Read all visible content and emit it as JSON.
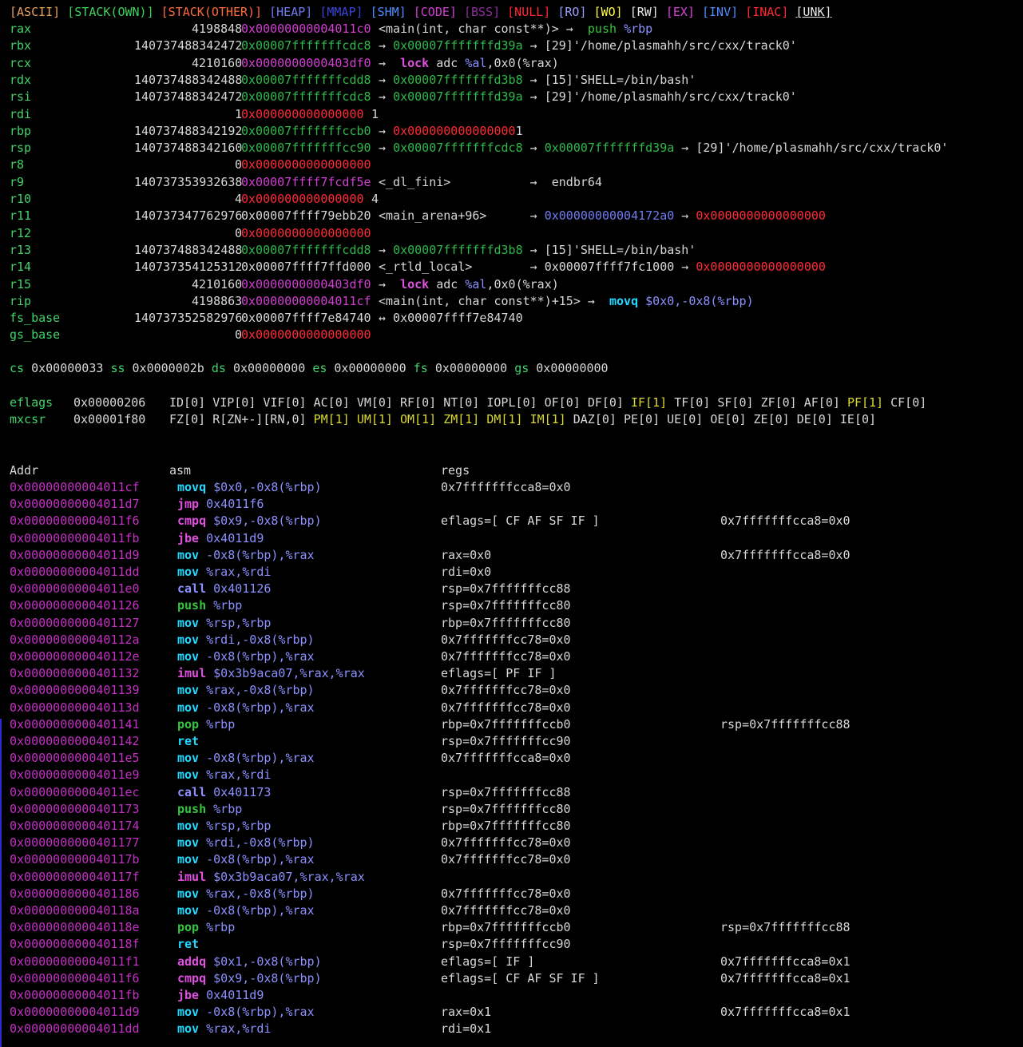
{
  "legend": [
    {
      "text": "[ASCII]",
      "cls": "c-ascii"
    },
    {
      "text": "[STACK(OWN)]",
      "cls": "c-stackown"
    },
    {
      "text": "[STACK(OTHER)]",
      "cls": "c-stackother"
    },
    {
      "text": "[HEAP]",
      "cls": "c-heap"
    },
    {
      "text": "[MMAP]",
      "cls": "c-mmap"
    },
    {
      "text": "[SHM]",
      "cls": "c-shm"
    },
    {
      "text": "[CODE]",
      "cls": "c-code"
    },
    {
      "text": "[BSS]",
      "cls": "c-bss"
    },
    {
      "text": "[NULL]",
      "cls": "c-null"
    },
    {
      "text": "[RO]",
      "cls": "c-ro"
    },
    {
      "text": "[WO]",
      "cls": "c-wo"
    },
    {
      "text": "[RW]",
      "cls": "c-rw"
    },
    {
      "text": "[EX]",
      "cls": "c-ex"
    },
    {
      "text": "[INV]",
      "cls": "c-inv"
    },
    {
      "text": "[INAC]",
      "cls": "c-inac"
    },
    {
      "text": "[UNK]",
      "cls": "c-unk u"
    }
  ],
  "registers": [
    {
      "name": "rax",
      "dec": "4198848",
      "hex": "0x00000000004011c0",
      "hexcls": "hex-mag",
      "rest": [
        [
          "<main(int, char const**)> → ",
          "plain"
        ],
        [
          " push ",
          "inst-green"
        ],
        [
          "%rbp",
          "operand-blue"
        ]
      ]
    },
    {
      "name": "rbx",
      "dec": "140737488342472",
      "hex": "0x00007fffffffcdc8",
      "hexcls": "hex-green",
      "rest": [
        [
          "→ ",
          "plain"
        ],
        [
          "0x00007fffffffd39a",
          "hex-green"
        ],
        [
          " → [29]'/home/plasmahh/src/cxx/track0'",
          "plain"
        ]
      ]
    },
    {
      "name": "rcx",
      "dec": "4210160",
      "hex": "0x0000000000403df0",
      "hexcls": "hex-mag",
      "rest": [
        [
          "→  ",
          "plain"
        ],
        [
          "lock ",
          "inst-mag"
        ],
        [
          "adc ",
          "plain"
        ],
        [
          "%al",
          "operand-blue"
        ],
        [
          ",0x0(%rax)",
          "plain"
        ]
      ]
    },
    {
      "name": "rdx",
      "dec": "140737488342488",
      "hex": "0x00007fffffffcdd8",
      "hexcls": "hex-green",
      "rest": [
        [
          "→ ",
          "plain"
        ],
        [
          "0x00007fffffffd3b8",
          "hex-green"
        ],
        [
          " → [15]'SHELL=/bin/bash'",
          "plain"
        ]
      ]
    },
    {
      "name": "rsi",
      "dec": "140737488342472",
      "hex": "0x00007fffffffcdc8",
      "hexcls": "hex-green",
      "rest": [
        [
          "→ ",
          "plain"
        ],
        [
          "0x00007fffffffd39a",
          "hex-green"
        ],
        [
          " → [29]'/home/plasmahh/src/cxx/track0'",
          "plain"
        ]
      ]
    },
    {
      "name": "rdi",
      "dec": "1",
      "hex": "0x000000000000000",
      "hexcls": "hex-red",
      "rest": [
        [
          "1",
          "plain"
        ]
      ]
    },
    {
      "name": "rbp",
      "dec": "140737488342192",
      "hex": "0x00007fffffffccb0",
      "hexcls": "hex-green",
      "rest": [
        [
          "→ ",
          "plain"
        ],
        [
          "0x000000000000000",
          "hex-red"
        ],
        [
          "1",
          "plain"
        ]
      ]
    },
    {
      "name": "rsp",
      "dec": "140737488342160",
      "hex": "0x00007fffffffcc90",
      "hexcls": "hex-green",
      "rest": [
        [
          "→ ",
          "plain"
        ],
        [
          "0x00007fffffffcdc8",
          "hex-green"
        ],
        [
          " → ",
          "plain"
        ],
        [
          "0x00007fffffffd39a",
          "hex-green"
        ],
        [
          " → [29]'/home/plasmahh/src/cxx/track0'",
          "plain"
        ]
      ]
    },
    {
      "name": "r8",
      "dec": "0",
      "hex": "0x0000000000000000",
      "hexcls": "hex-red",
      "rest": []
    },
    {
      "name": "r9",
      "dec": "140737353932638",
      "hex": "0x00007ffff7fcdf5e",
      "hexcls": "hex-mag",
      "rest": [
        [
          "<_dl_fini>           →  endbr64",
          "plain"
        ]
      ]
    },
    {
      "name": "r10",
      "dec": "4",
      "hex": "0x000000000000000",
      "hexcls": "hex-red",
      "rest": [
        [
          "4",
          "plain"
        ]
      ]
    },
    {
      "name": "r11",
      "dec": "140737347762976",
      "hex": "0x00007ffff79ebb20",
      "hexcls": "plain",
      "rest": [
        [
          "<main_arena+96>      → ",
          "plain"
        ],
        [
          "0x00000000004172a0",
          "c-heap"
        ],
        [
          " → ",
          "plain"
        ],
        [
          "0x0000000000000000",
          "hex-red"
        ]
      ]
    },
    {
      "name": "r12",
      "dec": "0",
      "hex": "0x0000000000000000",
      "hexcls": "hex-red",
      "rest": []
    },
    {
      "name": "r13",
      "dec": "140737488342488",
      "hex": "0x00007fffffffcdd8",
      "hexcls": "hex-green",
      "rest": [
        [
          "→ ",
          "plain"
        ],
        [
          "0x00007fffffffd3b8",
          "hex-green"
        ],
        [
          " → [15]'SHELL=/bin/bash'",
          "plain"
        ]
      ]
    },
    {
      "name": "r14",
      "dec": "140737354125312",
      "hex": "0x00007ffff7ffd000",
      "hexcls": "plain",
      "rest": [
        [
          "<_rtld_local>        → 0x00007ffff7fc1000 → ",
          "plain"
        ],
        [
          "0x0000000000000000",
          "hex-red"
        ]
      ]
    },
    {
      "name": "r15",
      "dec": "4210160",
      "hex": "0x0000000000403df0",
      "hexcls": "hex-mag",
      "rest": [
        [
          "→  ",
          "plain"
        ],
        [
          "lock ",
          "inst-mag"
        ],
        [
          "adc ",
          "plain"
        ],
        [
          "%al",
          "operand-blue"
        ],
        [
          ",0x0(%rax)",
          "plain"
        ]
      ]
    },
    {
      "name": "rip",
      "dec": "4198863",
      "hex": "0x00000000004011cf",
      "hexcls": "hex-mag",
      "rest": [
        [
          "<main(int, char const**)+15> →  ",
          "plain"
        ],
        [
          "movq ",
          "inst-cyan"
        ],
        [
          "$0x0,-0x8(%rbp)",
          "operand-blue"
        ]
      ]
    },
    {
      "name": "fs_base",
      "dec": "140737352582976",
      "hex": "0x00007ffff7e84740",
      "hexcls": "plain",
      "rest": [
        [
          "↔ 0x00007ffff7e84740",
          "plain"
        ]
      ]
    },
    {
      "name": "gs_base",
      "dec": "0",
      "hex": "0x0000000000000000",
      "hexcls": "hex-red",
      "rest": []
    }
  ],
  "segments": [
    {
      "k": "cs",
      "v": "0x00000033"
    },
    {
      "k": "ss",
      "v": "0x0000002b"
    },
    {
      "k": "ds",
      "v": "0x00000000"
    },
    {
      "k": "es",
      "v": "0x00000000"
    },
    {
      "k": "fs",
      "v": "0x00000000"
    },
    {
      "k": "gs",
      "v": "0x00000000"
    }
  ],
  "eflags": {
    "label": "eflags",
    "value": "0x00000206",
    "flags": [
      [
        "ID[0]",
        0
      ],
      [
        "VIP[0]",
        0
      ],
      [
        "VIF[0]",
        0
      ],
      [
        "AC[0]",
        0
      ],
      [
        "VM[0]",
        0
      ],
      [
        "RF[0]",
        0
      ],
      [
        "NT[0]",
        0
      ],
      [
        "IOPL[0]",
        0
      ],
      [
        "OF[0]",
        0
      ],
      [
        "DF[0]",
        0
      ],
      [
        "IF[1]",
        1
      ],
      [
        "TF[0]",
        0
      ],
      [
        "SF[0]",
        0
      ],
      [
        "ZF[0]",
        0
      ],
      [
        "AF[0]",
        0
      ],
      [
        "PF[1]",
        1
      ],
      [
        "CF[0]",
        0
      ]
    ]
  },
  "mxcsr": {
    "label": "mxcsr",
    "value": "0x00001f80",
    "flags": [
      [
        "FZ[0]",
        0
      ],
      [
        "R[ZN+-][RN,0]",
        0
      ],
      [
        "PM[1]",
        1
      ],
      [
        "UM[1]",
        1
      ],
      [
        "OM[1]",
        1
      ],
      [
        "ZM[1]",
        1
      ],
      [
        "DM[1]",
        1
      ],
      [
        "IM[1]",
        1
      ],
      [
        "DAZ[0]",
        0
      ],
      [
        "PE[0]",
        0
      ],
      [
        "UE[0]",
        0
      ],
      [
        "OE[0]",
        0
      ],
      [
        "ZE[0]",
        0
      ],
      [
        "DE[0]",
        0
      ],
      [
        "IE[0]",
        0
      ]
    ]
  },
  "trace_headers": {
    "addr": "Addr",
    "asm": "asm",
    "regs": "regs"
  },
  "trace": [
    [
      "0x00000000004011cf",
      "movq",
      "inst-cyan",
      "$0x0,-0x8(%rbp)",
      "0x7fffffffcca8=0x0",
      ""
    ],
    [
      "0x00000000004011d7",
      "jmp",
      "inst-mag",
      "0x4011f6",
      "",
      ""
    ],
    [
      "0x00000000004011f6",
      "cmpq",
      "inst-mag",
      "$0x9,-0x8(%rbp)",
      "eflags=[ CF AF SF IF ]",
      "0x7fffffffcca8=0x0"
    ],
    [
      "0x00000000004011fb",
      "jbe",
      "inst-mag",
      "0x4011d9",
      "",
      ""
    ],
    [
      "0x00000000004011d9",
      "mov",
      "inst-cyan",
      "-0x8(%rbp),%rax",
      "rax=0x0",
      "0x7fffffffcca8=0x0"
    ],
    [
      "0x00000000004011dd",
      "mov",
      "inst-cyan",
      "%rax,%rdi",
      "rdi=0x0",
      ""
    ],
    [
      "0x00000000004011e0",
      "call",
      "operand-blue",
      "0x401126",
      "rsp=0x7fffffffcc88",
      ""
    ],
    [
      "0x0000000000401126",
      "push",
      "inst-green",
      "%rbp",
      "rsp=0x7fffffffcc80",
      ""
    ],
    [
      "0x0000000000401127",
      "mov",
      "inst-cyan",
      "%rsp,%rbp",
      "rbp=0x7fffffffcc80",
      ""
    ],
    [
      "0x000000000040112a",
      "mov",
      "inst-cyan",
      "%rdi,-0x8(%rbp)",
      "0x7fffffffcc78=0x0",
      ""
    ],
    [
      "0x000000000040112e",
      "mov",
      "inst-cyan",
      "-0x8(%rbp),%rax",
      "0x7fffffffcc78=0x0",
      ""
    ],
    [
      "0x0000000000401132",
      "imul",
      "inst-mag",
      "$0x3b9aca07,%rax,%rax",
      "eflags=[ PF IF ]",
      ""
    ],
    [
      "0x0000000000401139",
      "mov",
      "inst-cyan",
      "%rax,-0x8(%rbp)",
      "0x7fffffffcc78=0x0",
      ""
    ],
    [
      "0x000000000040113d",
      "mov",
      "inst-cyan",
      "-0x8(%rbp),%rax",
      "0x7fffffffcc78=0x0",
      ""
    ],
    [
      "0x0000000000401141",
      "pop",
      "inst-green",
      "%rbp",
      "rbp=0x7fffffffccb0",
      "rsp=0x7fffffffcc88"
    ],
    [
      "0x0000000000401142",
      "ret",
      "inst-cyan",
      "",
      "rsp=0x7fffffffcc90",
      ""
    ],
    [
      "0x00000000004011e5",
      "mov",
      "inst-cyan",
      "-0x8(%rbp),%rax",
      "0x7fffffffcca8=0x0",
      ""
    ],
    [
      "0x00000000004011e9",
      "mov",
      "inst-cyan",
      "%rax,%rdi",
      "",
      ""
    ],
    [
      "0x00000000004011ec",
      "call",
      "operand-blue",
      "0x401173",
      "rsp=0x7fffffffcc88",
      ""
    ],
    [
      "0x0000000000401173",
      "push",
      "inst-green",
      "%rbp",
      "rsp=0x7fffffffcc80",
      ""
    ],
    [
      "0x0000000000401174",
      "mov",
      "inst-cyan",
      "%rsp,%rbp",
      "rbp=0x7fffffffcc80",
      ""
    ],
    [
      "0x0000000000401177",
      "mov",
      "inst-cyan",
      "%rdi,-0x8(%rbp)",
      "0x7fffffffcc78=0x0",
      ""
    ],
    [
      "0x000000000040117b",
      "mov",
      "inst-cyan",
      "-0x8(%rbp),%rax",
      "0x7fffffffcc78=0x0",
      ""
    ],
    [
      "0x000000000040117f",
      "imul",
      "inst-mag",
      "$0x3b9aca07,%rax,%rax",
      "",
      ""
    ],
    [
      "0x0000000000401186",
      "mov",
      "inst-cyan",
      "%rax,-0x8(%rbp)",
      "0x7fffffffcc78=0x0",
      ""
    ],
    [
      "0x000000000040118a",
      "mov",
      "inst-cyan",
      "-0x8(%rbp),%rax",
      "0x7fffffffcc78=0x0",
      ""
    ],
    [
      "0x000000000040118e",
      "pop",
      "inst-green",
      "%rbp",
      "rbp=0x7fffffffccb0",
      "rsp=0x7fffffffcc88"
    ],
    [
      "0x000000000040118f",
      "ret",
      "inst-cyan",
      "",
      "rsp=0x7fffffffcc90",
      ""
    ],
    [
      "0x00000000004011f1",
      "addq",
      "inst-mag",
      "$0x1,-0x8(%rbp)",
      "eflags=[ IF ]",
      "0x7fffffffcca8=0x1"
    ],
    [
      "0x00000000004011f6",
      "cmpq",
      "inst-mag",
      "$0x9,-0x8(%rbp)",
      "eflags=[ CF AF SF IF ]",
      "0x7fffffffcca8=0x1"
    ],
    [
      "0x00000000004011fb",
      "jbe",
      "inst-mag",
      "0x4011d9",
      "",
      ""
    ],
    [
      "0x00000000004011d9",
      "mov",
      "inst-cyan",
      "-0x8(%rbp),%rax",
      "rax=0x1",
      "0x7fffffffcca8=0x1"
    ],
    [
      "0x00000000004011dd",
      "mov",
      "inst-cyan",
      "%rax,%rdi",
      "rdi=0x1",
      ""
    ]
  ]
}
